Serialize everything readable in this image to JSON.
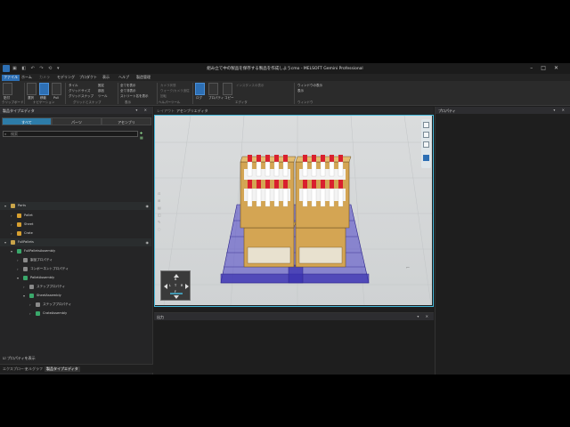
{
  "window": {
    "title": "組み立て中の製品を保存する製品を作成しようcmo - MELSOFT Gemini Professional",
    "quick_access": "▣ ◧ ↶ ↷ ⟲ ▾"
  },
  "ribbon": {
    "tabs": [
      {
        "label": "ファイル",
        "active": true
      },
      {
        "label": "ホーム",
        "active": false
      },
      {
        "label": "カメラ",
        "active": false
      },
      {
        "label": "モデリング",
        "active": false
      },
      {
        "label": "プロダクト",
        "active": false
      },
      {
        "label": "表示",
        "active": false
      },
      {
        "label": "ヘルプ",
        "active": false
      },
      {
        "label": "製造管理",
        "active": false
      }
    ],
    "small_items": {
      "tile": "タイル",
      "grid_size": "グリッドサイズ",
      "snap": "グリッドスナップ",
      "fix": "固定",
      "parts": "部品",
      "tool": "ツール",
      "show_all": "全てを表示",
      "hide_all": "全て非表示",
      "show_names": "ストリート名を表示",
      "camera_state": "カメラ状態",
      "walk_on": "ウォーク/カメラ追従",
      "rotate": "回転",
      "center": "中心",
      "fit": "ダブルに引き",
      "instance_disp": "インスタンスの表示",
      "window_mode": "ウィンドウの表示",
      "display": "表示"
    },
    "groups": [
      "クリップボード",
      "ナビゲーション",
      "グリッドとスナップ",
      "表示",
      "ヘルパーツール",
      "エディタ",
      "ウィンドウ"
    ],
    "buttons": [
      "貼付",
      "選択",
      "移動",
      "Pull",
      "ログ",
      "編集",
      "プロパティ",
      "コピー"
    ]
  },
  "left_panel": {
    "title": "製品タイプエディタ",
    "header_icons": "▾ ✕",
    "tabs": [
      "すべて",
      "パーツ",
      "アセンブリ"
    ],
    "search_placeholder": "検索",
    "search_icon": "⌕",
    "search_tools": "✚ ▦",
    "tree": [
      {
        "label": "Parts",
        "depth": 0,
        "expanded": true,
        "icon": "folder",
        "eye": true
      },
      {
        "label": "Pallet",
        "depth": 1,
        "expanded": false,
        "icon": "part",
        "eye": false
      },
      {
        "label": "Sheet",
        "depth": 1,
        "expanded": false,
        "icon": "part",
        "eye": false
      },
      {
        "label": "Crate",
        "depth": 1,
        "expanded": false,
        "icon": "part",
        "eye": false
      },
      {
        "label": "FullPallets",
        "depth": 0,
        "expanded": true,
        "icon": "folder",
        "eye": true
      },
      {
        "label": "FullPalletsAssembly",
        "depth": 1,
        "expanded": true,
        "icon": "assembly",
        "eye": false
      },
      {
        "label": "製品プロパティ",
        "depth": 2,
        "expanded": false,
        "icon": "prop",
        "eye": false
      },
      {
        "label": "コンポーネントプロパティ",
        "depth": 2,
        "expanded": false,
        "icon": "prop",
        "eye": false
      },
      {
        "label": "PalletAssembly",
        "depth": 2,
        "expanded": true,
        "icon": "assembly",
        "eye": false
      },
      {
        "label": "ステッププロパティ",
        "depth": 3,
        "expanded": false,
        "icon": "prop",
        "eye": false
      },
      {
        "label": "SheetAssembly",
        "depth": 3,
        "expanded": true,
        "icon": "assembly",
        "eye": false
      },
      {
        "label": "ステッププロパティ",
        "depth": 4,
        "expanded": false,
        "icon": "prop",
        "eye": false
      },
      {
        "label": "CrateAssembly",
        "depth": 4,
        "expanded": false,
        "icon": "assembly",
        "eye": false
      }
    ],
    "checkbox_label": "プロパティを表示",
    "bottom_tabs": [
      {
        "label": "エクスプローラ",
        "active": false
      },
      {
        "label": "セルグラフ",
        "active": false
      },
      {
        "label": "製品タイプエディタ",
        "active": true
      }
    ]
  },
  "center": {
    "doc_tabs": [
      "レイアウト",
      "アセンブリエディタ"
    ],
    "view_cube": {
      "top": "B",
      "left": "L",
      "right": "R",
      "bottom": "F",
      "center": "T"
    },
    "side_tools": [
      "⊡",
      "⊞",
      "▤",
      "◫",
      "✎",
      "◌"
    ]
  },
  "output": {
    "title": "出力",
    "icons": "▾ ✕"
  },
  "properties": {
    "title": "プロパティ",
    "icons": "▾ ✕"
  },
  "colors": {
    "accent": "#2d6fb4",
    "viewport_border": "#46b8da",
    "pallet": "#4b42c8",
    "crate": "#d4a553",
    "bottle_cap": "#d9202e"
  }
}
